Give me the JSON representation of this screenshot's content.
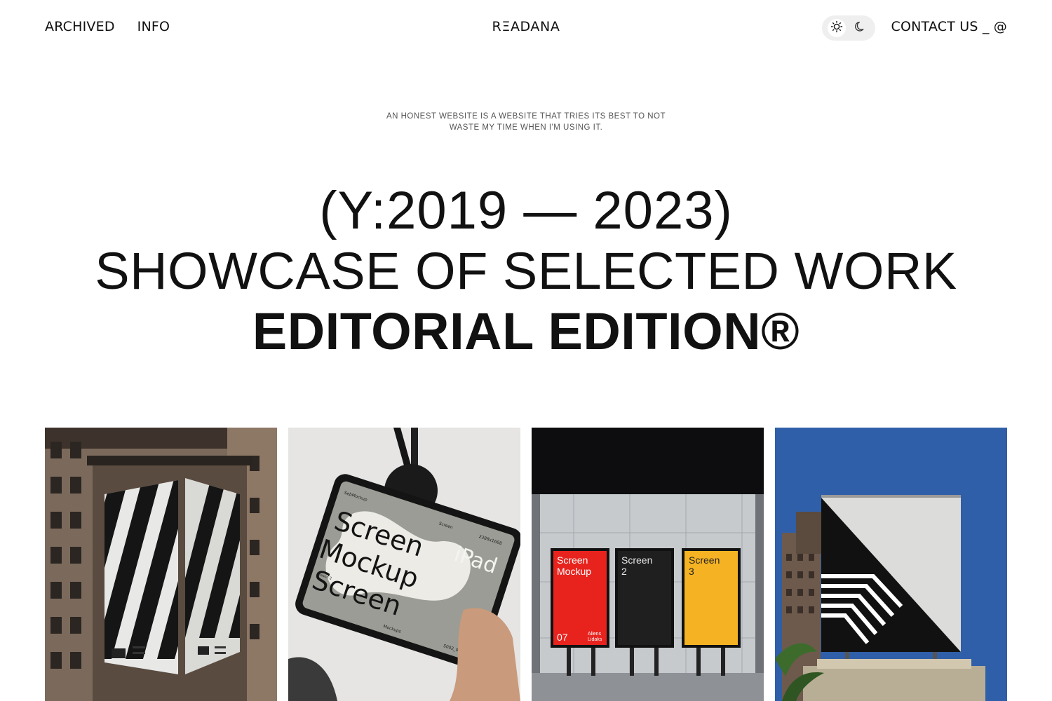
{
  "header": {
    "nav": [
      {
        "label": "ARCHIVED"
      },
      {
        "label": "INFO"
      }
    ],
    "brand": "RΞADANA",
    "theme_toggle": {
      "options": [
        {
          "icon": "sun-icon"
        },
        {
          "icon": "moon-icon"
        }
      ]
    },
    "contact_label": "CONTACT US _ @"
  },
  "tagline": {
    "line1": "AN HONEST WEBSITE IS A WEBSITE THAT TRIES ITS BEST TO NOT",
    "line2": "WASTE MY TIME WHEN I'M USING IT."
  },
  "hero": {
    "years": "(Y:2019 — 2023)",
    "showcase": "SHOWCASE OF SELECTED WORK",
    "edition": "EDITORIAL EDITION®"
  },
  "gallery": {
    "cards": [
      {
        "name": "building-billboard-stripes"
      },
      {
        "name": "ipad-screen-mockup",
        "texts": {
          "brand": "SebMockup",
          "screen": "Screen",
          "size": "2388x1668",
          "big1": "Screen",
          "big2": "Mockup",
          "big3": "Screen",
          "ipad": "iPad",
          "side": "Season 2",
          "mockups": "Mockups",
          "code": "S002_010"
        }
      },
      {
        "name": "subway-screen-posters",
        "posters": [
          {
            "title": "Screen\nMockup",
            "num": "07",
            "sub": "Aliens\nLidaks",
            "color": "#e8231e"
          },
          {
            "title": "Screen\n2",
            "num": "",
            "sub": "",
            "color": "#1f1f1f"
          },
          {
            "title": "Screen\n3",
            "num": "",
            "sub": "",
            "color": "#f5b323"
          }
        ]
      },
      {
        "name": "sky-billboard-triangle"
      }
    ]
  },
  "colors": {
    "text": "#111111",
    "toggle_bg": "#efefef",
    "sky": "#2f5fa8"
  }
}
